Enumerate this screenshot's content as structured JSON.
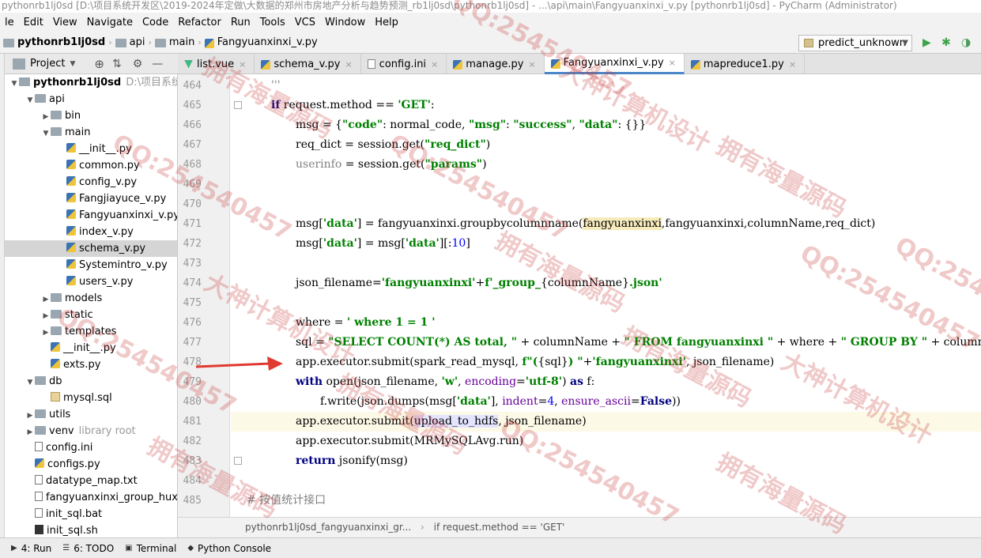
{
  "window": {
    "title": "pythonrb1lj0sd [D:\\项目系统开发区\\2019-2024年定做\\大数据的郑州市房地产分析与趋势预测_rb1lj0sd\\pythonrb1lj0sd] - ...\\api\\main\\Fangyuanxinxi_v.py [pythonrb1lj0sd] - PyCharm (Administrator)"
  },
  "menu": [
    "le",
    "Edit",
    "View",
    "Navigate",
    "Code",
    "Refactor",
    "Run",
    "Tools",
    "VCS",
    "Window",
    "Help"
  ],
  "breadcrumb": [
    "pythonrb1lj0sd",
    "api",
    "main",
    "Fangyuanxinxi_v.py"
  ],
  "run_config": "predict_unknown",
  "project_panel": {
    "label": "Project"
  },
  "tabs": [
    "list.vue",
    "schema_v.py",
    "config.ini",
    "manage.py",
    "Fangyuanxinxi_v.py",
    "mapreduce1.py"
  ],
  "tree": [
    {
      "label": "pythonrb1lj0sd",
      "hint": "D:\\项目系统开",
      "type": "folder",
      "level": 0,
      "open": true,
      "bold": true
    },
    {
      "label": "api",
      "type": "folder",
      "level": 1,
      "open": true
    },
    {
      "label": "bin",
      "type": "folder",
      "level": 2,
      "open": false
    },
    {
      "label": "main",
      "type": "folder",
      "level": 2,
      "open": true
    },
    {
      "label": "__init__.py",
      "type": "py",
      "level": 3
    },
    {
      "label": "common.py",
      "type": "py",
      "level": 3
    },
    {
      "label": "config_v.py",
      "type": "py",
      "level": 3
    },
    {
      "label": "Fangjiayuce_v.py",
      "type": "py",
      "level": 3
    },
    {
      "label": "Fangyuanxinxi_v.py",
      "type": "py",
      "level": 3
    },
    {
      "label": "index_v.py",
      "type": "py",
      "level": 3
    },
    {
      "label": "schema_v.py",
      "type": "py",
      "level": 3,
      "selected": true
    },
    {
      "label": "Systemintro_v.py",
      "type": "py",
      "level": 3
    },
    {
      "label": "users_v.py",
      "type": "py",
      "level": 3
    },
    {
      "label": "models",
      "type": "folder",
      "level": 2,
      "open": false
    },
    {
      "label": "static",
      "type": "folder",
      "level": 2,
      "open": false
    },
    {
      "label": "templates",
      "type": "folder",
      "level": 2,
      "open": false
    },
    {
      "label": "__init__.py",
      "type": "py",
      "level": 2
    },
    {
      "label": "exts.py",
      "type": "py",
      "level": 2
    },
    {
      "label": "db",
      "type": "folder",
      "level": 1,
      "open": true
    },
    {
      "label": "mysql.sql",
      "type": "sql",
      "level": 2
    },
    {
      "label": "utils",
      "type": "folder",
      "level": 1,
      "open": false
    },
    {
      "label": "venv",
      "hint": "library root",
      "type": "folder",
      "level": 1,
      "open": false
    },
    {
      "label": "config.ini",
      "type": "txt",
      "level": 1
    },
    {
      "label": "configs.py",
      "type": "py",
      "level": 1
    },
    {
      "label": "datatype_map.txt",
      "type": "txt",
      "level": 1
    },
    {
      "label": "fangyuanxinxi_group_huxing",
      "type": "txt",
      "level": 1
    },
    {
      "label": "init_sql.bat",
      "type": "txt",
      "level": 1
    },
    {
      "label": "init_sql.sh",
      "type": "sh",
      "level": 1
    }
  ],
  "code": {
    "first_line": 464,
    "lines": [
      {
        "html": "<span class='gray'>'''</span>",
        "indent": 1
      },
      {
        "html": "<span class='kw'>if</span> request.method == <span class='str'>'GET'</span>:",
        "indent": 1
      },
      {
        "html": "msg = {<span class='str'>\"code\"</span>: normal_code, <span class='str'>\"msg\"</span>: <span class='str'>\"success\"</span>, <span class='str'>\"data\"</span>: {}}",
        "indent": 2
      },
      {
        "html": "req_dict = session.get(<span class='str'>\"req_dict\"</span>)",
        "indent": 2
      },
      {
        "html": "<span class='gray'>userinfo</span> = session.get(<span class='str'>\"params\"</span>)",
        "indent": 2
      },
      {
        "html": "",
        "indent": 0
      },
      {
        "html": "",
        "indent": 0
      },
      {
        "html": "msg[<span class='str'>'data'</span>] = fangyuanxinxi.groupbycolumnname(<span class='usg'>fangyuanxinxi</span>,fangyuanxinxi,columnName,req_dict)",
        "indent": 2
      },
      {
        "html": "msg[<span class='str'>'data'</span>] = msg[<span class='str'>'data'</span>][:<span class='num'>10</span>]",
        "indent": 2
      },
      {
        "html": "",
        "indent": 0
      },
      {
        "html": "json_filename=<span class='str'>'fangyuanxinxi'</span>+<span class='str'>f'_group_</span>{columnName}<span class='str'>.json'</span>",
        "indent": 2
      },
      {
        "html": "",
        "indent": 0
      },
      {
        "html": "where = <span class='str'>' where 1 = 1 '</span>",
        "indent": 2
      },
      {
        "html": "sql = <span class='str'>\"SELECT COUNT(*) AS total, \"</span> + columnName + <span class='str'>\" FROM fangyuanxinxi \"</span> + where + <span class='str'>\" GROUP BY \"</span> + columnName",
        "indent": 2
      },
      {
        "html": "app.executor.submit(spark_read_mysql, <span class='str'>f\"(</span>{sql}<span class='str'>) \"</span>+<span class='str'>'fangyuanxinxi'</span>, json_filename)",
        "indent": 2
      },
      {
        "html": "<span class='kw'>with</span> open(json_filename, <span class='str'>'w'</span>, <span class='param'>encoding</span>=<span class='str'>'utf-8'</span>) <span class='kw'>as</span> f:",
        "indent": 2
      },
      {
        "html": "f.write(json.dumps(msg[<span class='str'>'data'</span>], <span class='param'>indent</span>=<span class='num'>4</span>, <span class='param'>ensure_ascii</span>=<span class='kw'>False</span>))",
        "indent": 3
      },
      {
        "html": "app.executor.submit(<span style='background:#e4e4ff'>upload_to_hdfs</span>, json_filename)",
        "indent": 2,
        "hl": true
      },
      {
        "html": "app.executor.submit(MRMySQLAvg.run)",
        "indent": 2
      },
      {
        "html": "<span class='kw'>return</span> jsonify(msg)",
        "indent": 2
      },
      {
        "html": "",
        "indent": 0
      },
      {
        "html": "<span class='cmtline'># 按值统计接口</span>",
        "indent": 0
      }
    ]
  },
  "editor_breadcrumb": [
    "pythonrb1lj0sd_fangyuanxinxi_gr...",
    "if request.method == 'GET'"
  ],
  "bottom_tools": [
    {
      "label": "4: Run"
    },
    {
      "label": "6: TODO"
    },
    {
      "label": "Terminal"
    },
    {
      "label": "Python Console"
    }
  ],
  "watermarks": [
    "QQ:254540457",
    "拥有海量源码",
    "大神计算机设计"
  ]
}
